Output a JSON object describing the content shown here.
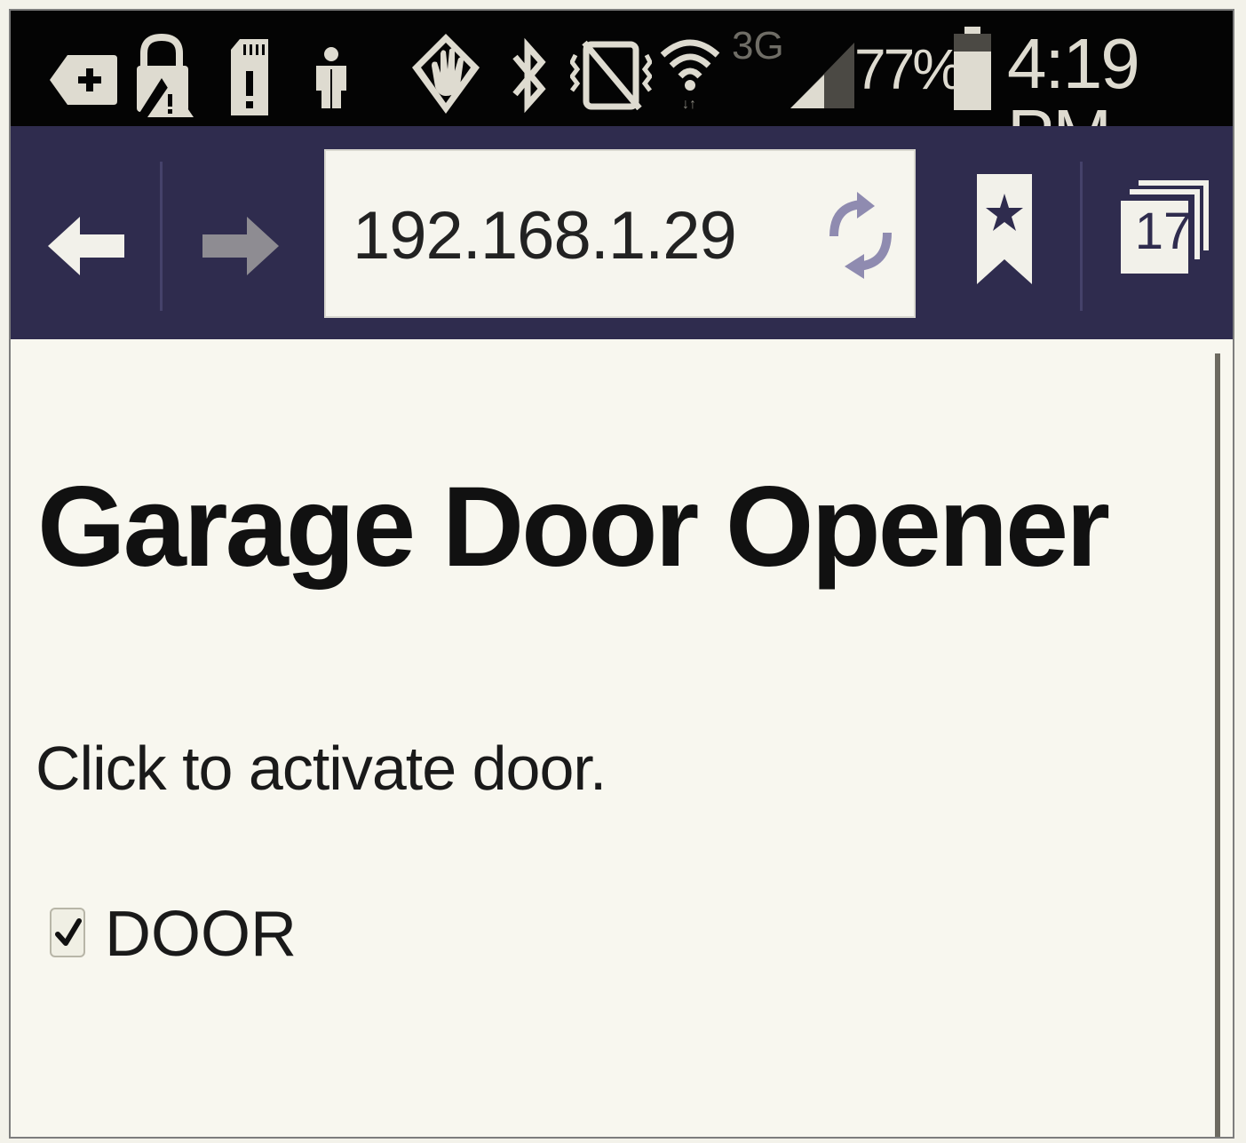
{
  "status_bar": {
    "network_type": "3G",
    "battery_percent": "77%",
    "time": "4:19 PM",
    "icons": [
      "add-notification-icon",
      "lock-warning-icon",
      "sd-card-alert-icon",
      "person-icon",
      "gesture-icon",
      "bluetooth-icon",
      "vibrate-mute-icon",
      "wifi-icon",
      "signal-icon",
      "battery-icon"
    ],
    "battery_level": 0.77
  },
  "toolbar": {
    "url": "192.168.1.29",
    "tab_count": "17",
    "icons": [
      "back-arrow-icon",
      "forward-arrow-icon",
      "reload-icon",
      "bookmark-icon",
      "tabs-icon"
    ]
  },
  "page": {
    "title": "Garage Door Opener",
    "instructions": "Click to activate door.",
    "door_checkbox": {
      "label": "DOOR",
      "checked": true
    }
  },
  "colors": {
    "status_bar_bg": "#040404",
    "toolbar_bg": "#2f2c4e",
    "page_bg": "#f8f7ef",
    "url_box_bg": "#f6f5ee",
    "reload_icon": "#8f8bb0"
  }
}
